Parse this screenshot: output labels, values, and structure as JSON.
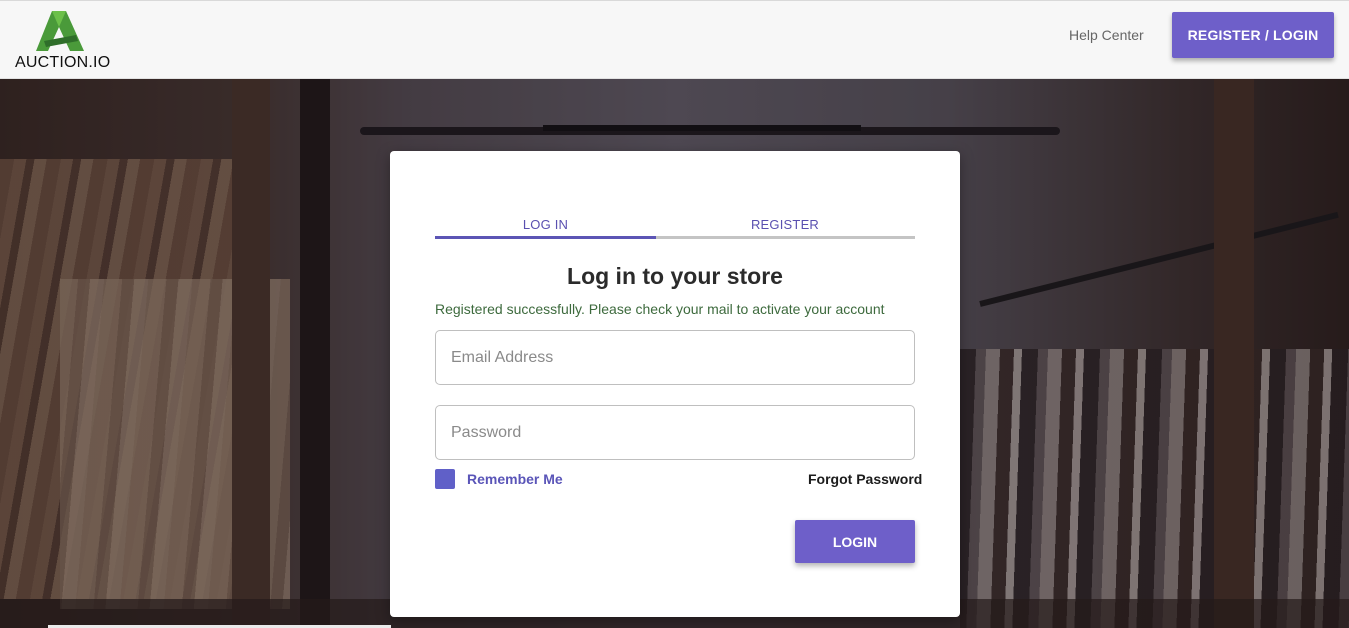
{
  "header": {
    "logo_text": "AUCTION.IO",
    "help_label": "Help Center",
    "register_login_label": "REGISTER / LOGIN"
  },
  "card": {
    "tabs": [
      {
        "label": "LOG IN",
        "active": true
      },
      {
        "label": "REGISTER",
        "active": false
      }
    ],
    "title": "Log in to your store",
    "message": "Registered successfully. Please check your mail to activate your account",
    "email_placeholder": "Email Address",
    "password_placeholder": "Password",
    "remember_label": "Remember Me",
    "forgot_label": "Forgot Password",
    "login_label": "LOGIN"
  },
  "colors": {
    "accent": "#6e5fc9",
    "tab_text": "#5a50b0",
    "success_text": "#3d6a3d",
    "logo_green": "#4a9a3a"
  },
  "icons": {
    "logo": "auction-logo-icon",
    "checkbox": "checkbox-icon"
  }
}
